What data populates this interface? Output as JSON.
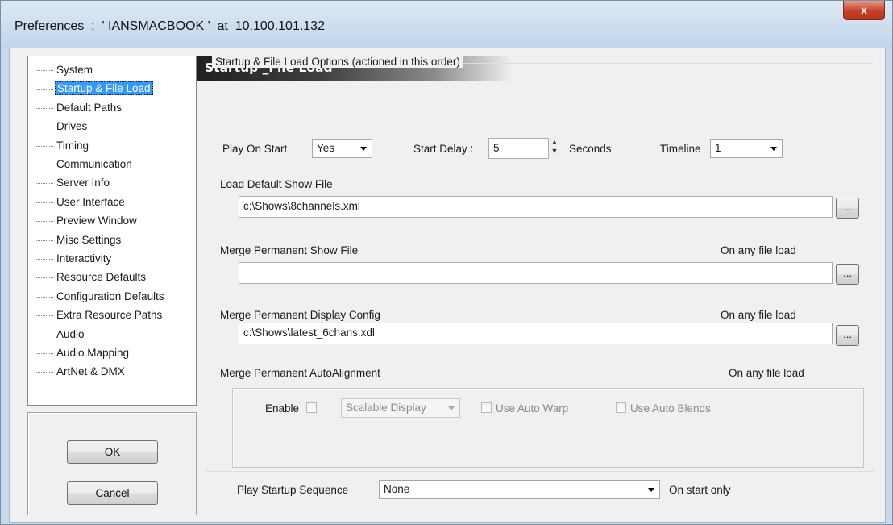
{
  "window": {
    "title": "Preferences  :  ' IANSMACBOOK '  at  10.100.101.132",
    "close_symbol": "x"
  },
  "tree": {
    "items": [
      {
        "label": "System"
      },
      {
        "label": "Startup & File Load",
        "selected": true
      },
      {
        "label": "Default Paths"
      },
      {
        "label": "Drives"
      },
      {
        "label": "Timing"
      },
      {
        "label": "Communication"
      },
      {
        "label": "Server Info"
      },
      {
        "label": "User Interface"
      },
      {
        "label": "Preview Window"
      },
      {
        "label": "Misc Settings"
      },
      {
        "label": "Interactivity"
      },
      {
        "label": "Resource Defaults"
      },
      {
        "label": "Configuration Defaults"
      },
      {
        "label": "Extra Resource Paths"
      },
      {
        "label": "Audio"
      },
      {
        "label": "Audio Mapping"
      },
      {
        "label": "ArtNet & DMX"
      }
    ]
  },
  "buttons": {
    "ok": "OK",
    "cancel": "Cancel"
  },
  "page": {
    "header": "Startup _File Load",
    "group_title": "Startup & File Load Options (actioned in this order)",
    "play_on_start": {
      "label": "Play On Start",
      "value": "Yes"
    },
    "start_delay": {
      "label": "Start Delay :",
      "value": "5",
      "unit": "Seconds"
    },
    "timeline": {
      "label": "Timeline",
      "value": "1"
    },
    "load_default": {
      "label": "Load Default Show File",
      "value": "c:\\Shows\\8channels.xml",
      "browse": "..."
    },
    "merge_show": {
      "label": "Merge Permanent Show File",
      "note": "On any file load",
      "value": "",
      "browse": "..."
    },
    "merge_display": {
      "label": "Merge Permanent Display Config",
      "note": "On any file load",
      "value": "c:\\Shows\\latest_6chans.xdl",
      "browse": "..."
    },
    "merge_auto": {
      "label": "Merge Permanent AutoAlignment",
      "note": "On any file load",
      "enable_label": "Enable",
      "enabled": false,
      "mode": "Scalable Display",
      "use_auto_warp": "Use Auto Warp",
      "use_auto_blends": "Use Auto Blends"
    },
    "startup_sequence": {
      "label": "Play Startup Sequence",
      "value": "None",
      "note": "On start only"
    }
  }
}
